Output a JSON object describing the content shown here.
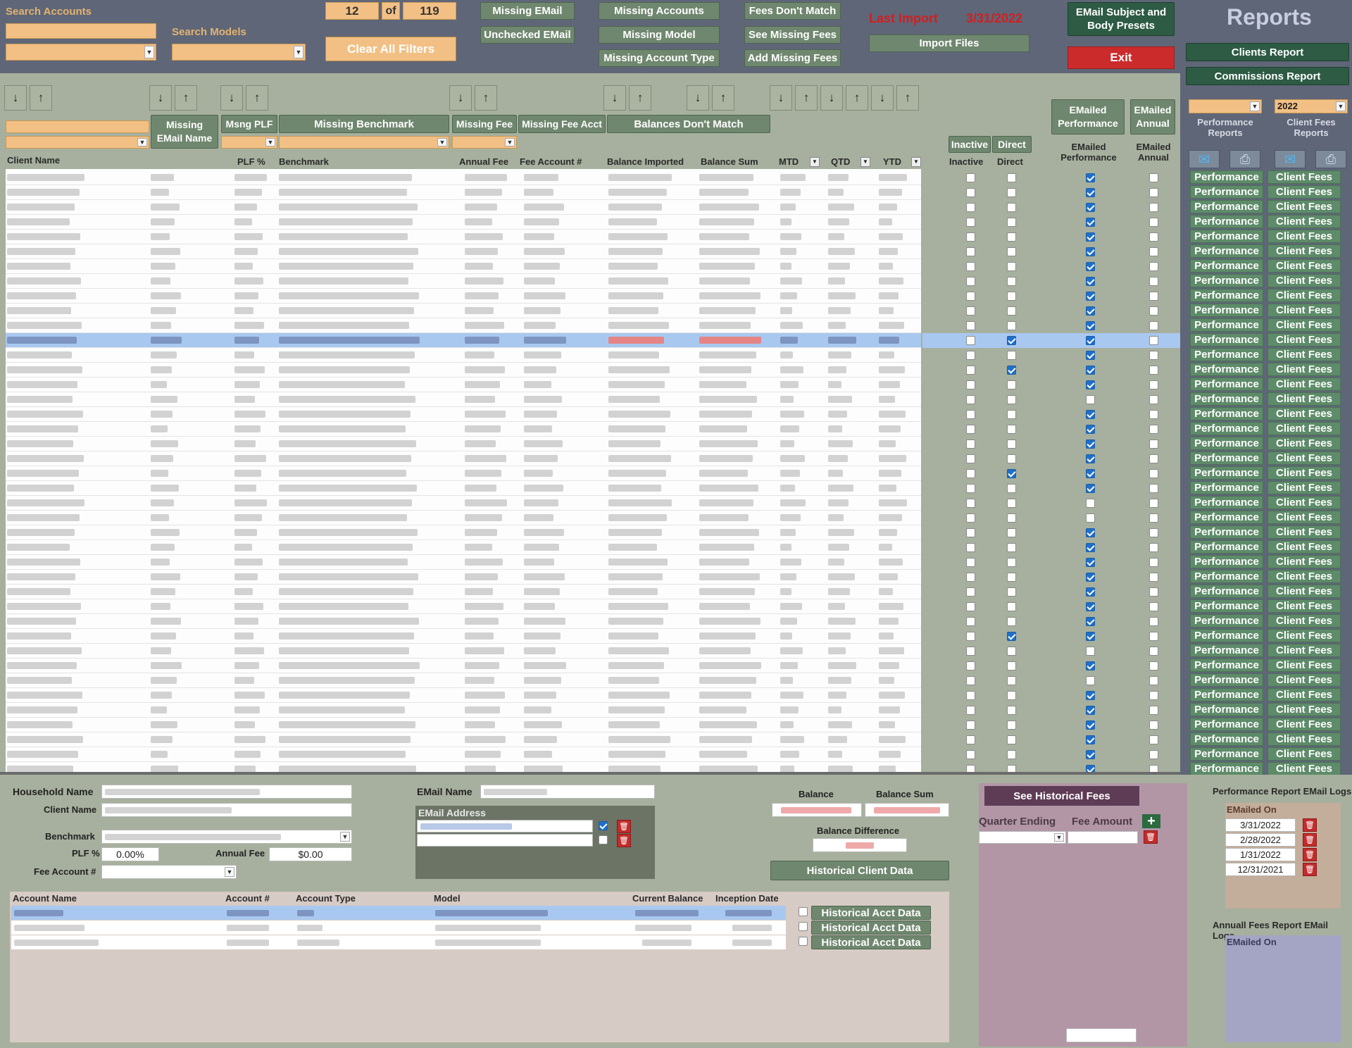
{
  "header": {
    "search_accounts_label": "Search Accounts",
    "search_models_label": "Search Models",
    "record_current": "12",
    "record_of": "of",
    "record_total": "119",
    "clear_filters": "Clear All Filters",
    "btn_missing_email": "Missing EMail",
    "btn_unchecked_email": "Unchecked EMail",
    "btn_missing_accounts": "Missing Accounts",
    "btn_missing_model": "Missing Model",
    "btn_missing_account_type": "Missing Account Type",
    "btn_fees_dont_match": "Fees Don't Match",
    "btn_see_missing_fees": "See Missing Fees",
    "btn_add_missing_fees": "Add Missing Fees",
    "last_import_label": "Last Import",
    "last_import_date": "3/31/2022",
    "import_files": "Import Files",
    "email_presets": "EMail Subject and Body Presets",
    "exit": "Exit"
  },
  "reports": {
    "title": "Reports",
    "clients_report": "Clients Report",
    "commissions_report": "Commissions Report",
    "year_value": "2022",
    "perf_reports_label": "Performance Reports",
    "client_fees_reports_label": "Client Fees Reports",
    "perf_btn": "Performance",
    "fees_btn": "Client Fees"
  },
  "filters": {
    "missing_email_name": "Missing EMail Name",
    "msng_plf": "Msng PLF",
    "missing_benchmark": "Missing Benchmark",
    "missing_fee": "Missing Fee",
    "missing_fee_acct": "Missing Fee Acct",
    "balances_dont_match": "Balances Don't Match",
    "inactive": "Inactive",
    "direct": "Direct",
    "emailed_performance": "EMailed Performance",
    "emailed_annual": "EMailed Annual"
  },
  "columns": {
    "client_name": "Client Name",
    "plf": "PLF %",
    "benchmark": "Benchmark",
    "annual_fee": "Annual Fee",
    "fee_account": "Fee Account #",
    "balance_imported": "Balance Imported",
    "balance_sum": "Balance Sum",
    "mtd": "MTD",
    "qtd": "QTD",
    "ytd": "YTD",
    "inactive": "Inactive",
    "direct": "Direct",
    "emailed_performance": "EMailed Performance",
    "emailed_annual": "EMailed Annual"
  },
  "rows_flags": [
    {
      "d": 0,
      "p": 1
    },
    {
      "d": 0,
      "p": 1
    },
    {
      "d": 0,
      "p": 1
    },
    {
      "d": 0,
      "p": 1
    },
    {
      "d": 0,
      "p": 1
    },
    {
      "d": 0,
      "p": 1
    },
    {
      "d": 0,
      "p": 1
    },
    {
      "d": 0,
      "p": 1
    },
    {
      "d": 0,
      "p": 1
    },
    {
      "d": 0,
      "p": 1
    },
    {
      "d": 0,
      "p": 1
    },
    {
      "d": 1,
      "p": 1,
      "sel": 1
    },
    {
      "d": 0,
      "p": 1
    },
    {
      "d": 1,
      "p": 1
    },
    {
      "d": 0,
      "p": 1
    },
    {
      "d": 0,
      "p": 0
    },
    {
      "d": 0,
      "p": 1
    },
    {
      "d": 0,
      "p": 1
    },
    {
      "d": 0,
      "p": 1
    },
    {
      "d": 0,
      "p": 1
    },
    {
      "d": 1,
      "p": 1
    },
    {
      "d": 0,
      "p": 1
    },
    {
      "d": 0,
      "p": 0
    },
    {
      "d": 0,
      "p": 0
    },
    {
      "d": 0,
      "p": 1
    },
    {
      "d": 0,
      "p": 1
    },
    {
      "d": 0,
      "p": 1
    },
    {
      "d": 0,
      "p": 1
    },
    {
      "d": 0,
      "p": 1
    },
    {
      "d": 0,
      "p": 1
    },
    {
      "d": 0,
      "p": 1
    },
    {
      "d": 1,
      "p": 1
    },
    {
      "d": 0,
      "p": 0
    },
    {
      "d": 0,
      "p": 1
    },
    {
      "d": 0,
      "p": 0
    },
    {
      "d": 0,
      "p": 1
    },
    {
      "d": 0,
      "p": 1
    },
    {
      "d": 0,
      "p": 1
    },
    {
      "d": 0,
      "p": 1
    },
    {
      "d": 0,
      "p": 1
    },
    {
      "d": 0,
      "p": 1
    }
  ],
  "detail": {
    "household_name": "Household Name",
    "client_name": "Client Name",
    "benchmark": "Benchmark",
    "plf": "PLF %",
    "plf_value": "0.00%",
    "annual_fee": "Annual Fee",
    "annual_fee_value": "$0.00",
    "fee_account": "Fee Account #",
    "email_name": "EMail Name",
    "email_address": "EMail Address",
    "balance": "Balance",
    "balance_sum": "Balance Sum",
    "balance_difference": "Balance Difference",
    "historical_client_data": "Historical Client Data",
    "account_name": "Account Name",
    "account_num": "Account #",
    "account_type": "Account Type",
    "model": "Model",
    "current_balance": "Current Balance",
    "inception_date": "Inception Date",
    "historical_acct_data": "Historical Acct Data"
  },
  "fees": {
    "see_historical": "See Historical Fees",
    "quarter_ending": "Quarter Ending",
    "fee_amount": "Fee Amount"
  },
  "email_logs": {
    "perf_title": "Performance Report EMail Logs",
    "annual_title": "Annuall Fees Report EMail Logs",
    "emailed_on": "EMailed On",
    "perf_dates": [
      "3/31/2022",
      "2/28/2022",
      "1/31/2022",
      "12/31/2021"
    ]
  },
  "colors": {
    "header_bg": "#5f6678",
    "tan": "#f2c085",
    "green": "#6f876e",
    "red": "#cc2b2b",
    "selection": "#a9c8f0"
  }
}
